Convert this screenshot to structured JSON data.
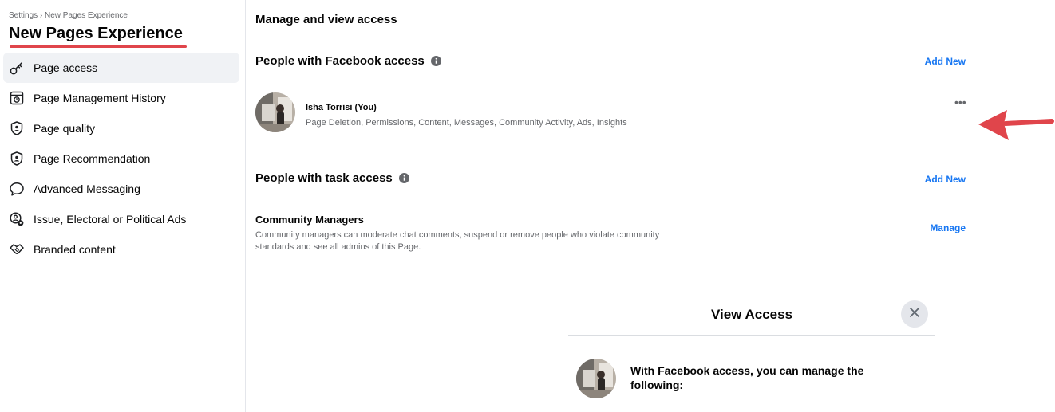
{
  "sidebar": {
    "breadcrumb": "Settings › New Pages Experience",
    "title": "New Pages Experience",
    "items": [
      {
        "label": "Page access",
        "icon": "key-icon",
        "active": true
      },
      {
        "label": "Page Management History",
        "icon": "history-icon"
      },
      {
        "label": "Page quality",
        "icon": "shield-person-icon"
      },
      {
        "label": "Page Recommendation",
        "icon": "shield-person-icon"
      },
      {
        "label": "Advanced Messaging",
        "icon": "speech-bubble-icon"
      },
      {
        "label": "Issue, Electoral or Political Ads",
        "icon": "ads-settings-icon"
      },
      {
        "label": "Branded content",
        "icon": "handshake-icon"
      }
    ]
  },
  "main": {
    "heading": "Manage and view access",
    "facebook_access": {
      "title": "People with Facebook access",
      "add_label": "Add New",
      "person": {
        "name": "Isha Torrisi (You)",
        "permissions": "Page Deletion, Permissions, Content, Messages, Community Activity, Ads, Insights",
        "more_label": "•••"
      }
    },
    "task_access": {
      "title": "People with task access",
      "add_label": "Add New",
      "community_managers": {
        "title": "Community Managers",
        "description": "Community managers can moderate chat comments, suspend or remove people who violate community standards and see all admins of this Page.",
        "manage_label": "Manage"
      }
    }
  },
  "view_access_panel": {
    "title": "View Access",
    "text": "With Facebook access, you can manage the following:"
  },
  "colors": {
    "link": "#1877f2",
    "annotation_red": "#e0454b",
    "active_bg": "#f0f2f5"
  }
}
